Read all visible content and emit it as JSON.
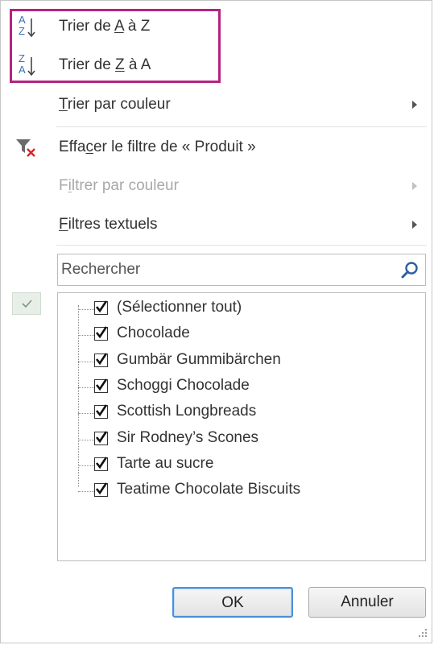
{
  "menu": {
    "sort_az": {
      "prefix": "Trier de ",
      "key": "A",
      "suffix": " à Z",
      "icon_top": "A",
      "icon_bottom": "Z"
    },
    "sort_za": {
      "prefix": "Trier de ",
      "key": "Z",
      "suffix": " à A",
      "icon_top": "Z",
      "icon_bottom": "A"
    },
    "sort_color": {
      "key": "T",
      "rest": "rier par couleur"
    },
    "clear_filter": {
      "pre": "Effa",
      "key": "c",
      "rest": "er le filtre de « Produit »"
    },
    "filter_color": {
      "pre": "F",
      "key": "i",
      "rest": "ltrer par couleur",
      "enabled": false
    },
    "text_filters": {
      "key": "F",
      "rest": "iltres textuels"
    }
  },
  "search": {
    "placeholder": "Rechercher",
    "value": ""
  },
  "list": {
    "items": [
      {
        "label": "(Sélectionner tout)",
        "checked": true
      },
      {
        "label": "Chocolade",
        "checked": true
      },
      {
        "label": "Gumbär Gummibärchen",
        "checked": true
      },
      {
        "label": "Schoggi Chocolade",
        "checked": true
      },
      {
        "label": "Scottish Longbreads",
        "checked": true
      },
      {
        "label": "Sir Rodney’s Scones",
        "checked": true
      },
      {
        "label": "Tarte au sucre",
        "checked": true
      },
      {
        "label": "Teatime Chocolate Biscuits",
        "checked": true
      }
    ]
  },
  "buttons": {
    "ok": "OK",
    "cancel": "Annuler"
  },
  "colors": {
    "highlight": "#b4237f",
    "sort_icon": "#3b6fb6",
    "clear_icon_x": "#d9232a"
  },
  "icons": {
    "sort_az": "sort-ascending-icon",
    "sort_za": "sort-descending-icon",
    "clear_filter": "clear-filter-icon",
    "search": "search-icon",
    "submenu": "chevron-right-icon"
  }
}
